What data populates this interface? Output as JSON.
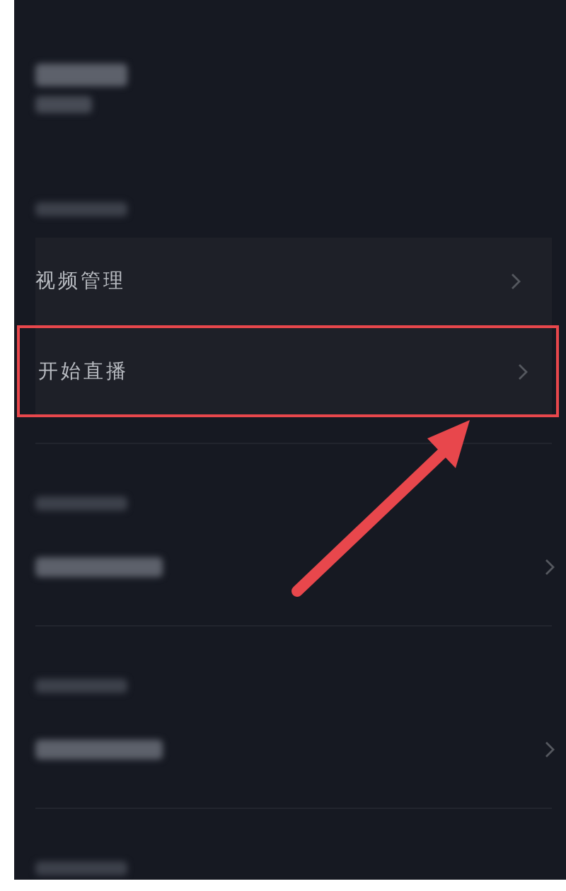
{
  "blocks": [
    {
      "kind": "blurred_title"
    },
    {
      "kind": "blurred_subtitle"
    },
    {
      "kind": "blurred_header"
    },
    {
      "kind": "card",
      "items": [
        {
          "label": "视频管理",
          "highlighted": false
        },
        {
          "label": "开始直播",
          "highlighted": true
        }
      ]
    },
    {
      "kind": "divider"
    },
    {
      "kind": "blurred_header"
    },
    {
      "kind": "blurred_row"
    },
    {
      "kind": "divider"
    },
    {
      "kind": "blurred_header"
    },
    {
      "kind": "blurred_row"
    },
    {
      "kind": "divider"
    },
    {
      "kind": "blurred_header"
    }
  ],
  "annotation": {
    "kind": "arrow"
  }
}
